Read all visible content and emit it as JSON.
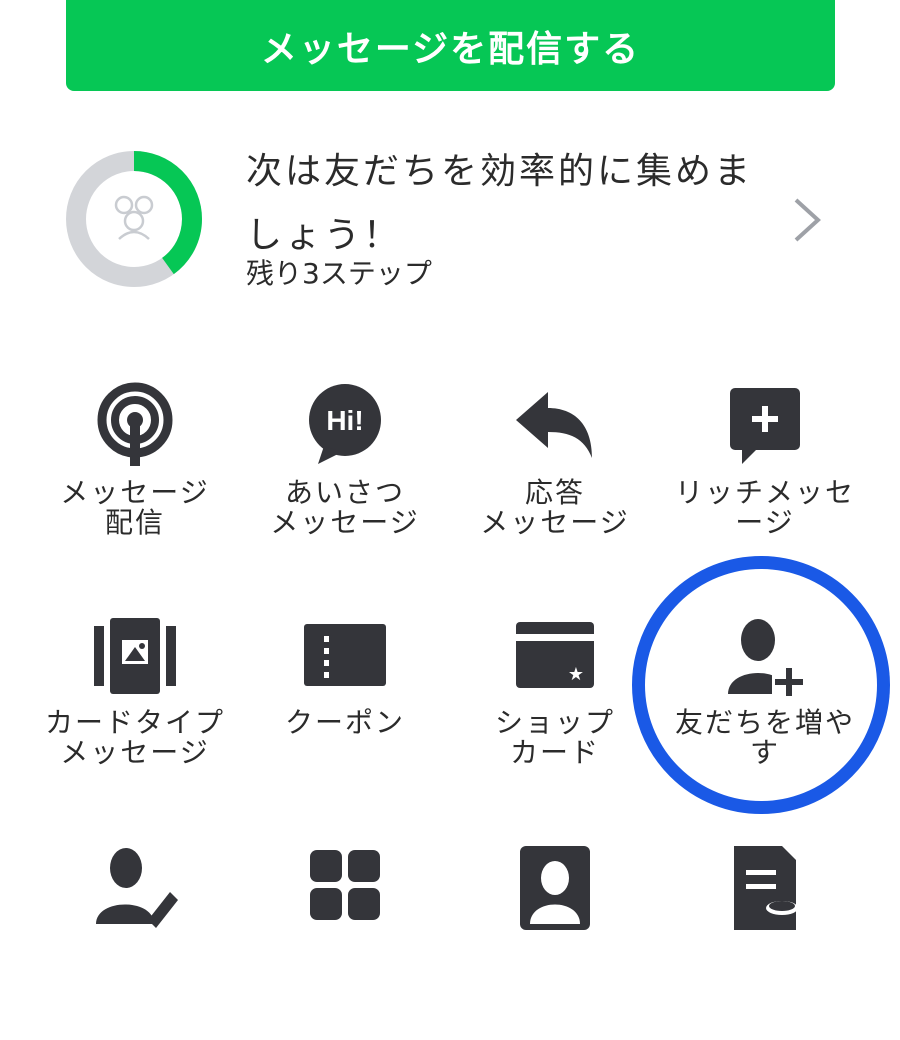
{
  "header": {
    "cta_label": "メッセージを配信する"
  },
  "progress": {
    "title": "次は友だちを効率的に集めましょう！",
    "remaining": "残り3ステップ",
    "fraction_complete": 0.4,
    "colors": {
      "done": "#06c755",
      "todo": "#d3d5d9"
    }
  },
  "menu": {
    "items": [
      {
        "label": "メッセージ\n配信",
        "icon": "broadcast-icon"
      },
      {
        "label": "あいさつ\nメッセージ",
        "icon": "hi-speech-bubble-icon"
      },
      {
        "label": "応答\nメッセージ",
        "icon": "reply-arrow-icon"
      },
      {
        "label": "リッチメッセ\nージ",
        "icon": "plus-chat-icon"
      },
      {
        "label": "カードタイプ\nメッセージ",
        "icon": "card-carousel-icon"
      },
      {
        "label": "クーポン",
        "icon": "coupon-icon"
      },
      {
        "label": "ショップ\nカード",
        "icon": "shop-card-icon"
      },
      {
        "label": "友だちを増や\nす",
        "icon": "add-friend-icon"
      },
      {
        "label": "",
        "icon": "edit-profile-icon"
      },
      {
        "label": "",
        "icon": "grid-menu-icon"
      },
      {
        "label": "",
        "icon": "profile-card-icon"
      },
      {
        "label": "",
        "icon": "document-coin-icon"
      }
    ]
  },
  "colors": {
    "accent": "#06c755",
    "highlight": "#1a59e6",
    "icon": "#34353a"
  }
}
